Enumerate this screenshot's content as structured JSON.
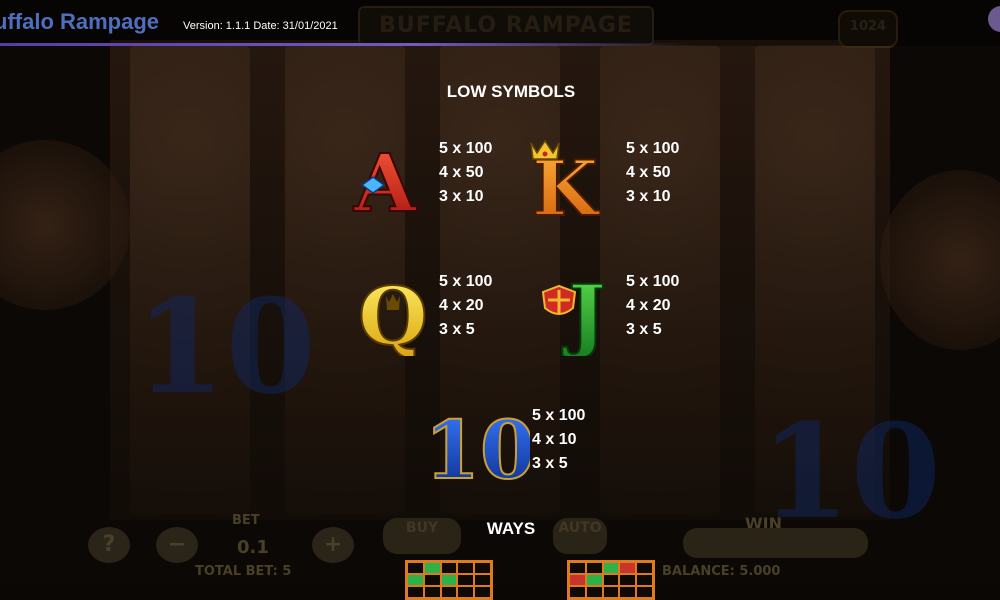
{
  "header": {
    "app_title": "uffalo Rampage",
    "version_text": "Version: 1.1.1    Date: 31/01/2021"
  },
  "background": {
    "logo_text": "BUFFALO RAMPAGE",
    "ways_badge": "1024",
    "bet_label": "BET",
    "bet_value": "0.1",
    "buy_label": "BUY",
    "auto_label": "AUTO",
    "win_label": "WIN",
    "total_bet": "TOTAL BET: 5",
    "balance": "BALANCE: 5.000",
    "help_icon": "?",
    "minus_icon": "−",
    "plus_icon": "+",
    "ten_glyph": "10"
  },
  "low_symbols": {
    "title": "LOW SYMBOLS",
    "items": [
      {
        "symbol": "A",
        "pays": [
          "5 x 100",
          "4 x 50",
          "3 x 10"
        ],
        "color": "#d42a1f"
      },
      {
        "symbol": "K",
        "pays": [
          "5 x 100",
          "4 x 50",
          "3 x 10"
        ],
        "color": "#f08a16"
      },
      {
        "symbol": "Q",
        "pays": [
          "5 x 100",
          "4 x 20",
          "3 x 5"
        ],
        "color": "#f7d21c"
      },
      {
        "symbol": "J",
        "pays": [
          "5 x 100",
          "4 x 20",
          "3 x 5"
        ],
        "color": "#2aa436"
      },
      {
        "symbol": "10",
        "pays": [
          "5 x 100",
          "4 x 10",
          "3 x 5"
        ],
        "color": "#1a43b8"
      }
    ]
  },
  "ways": {
    "title": "WAYS"
  },
  "colors": {
    "title_accent": "#4f6fbe",
    "grid_border": "#e07a1c",
    "grid_green": "#2bb34a",
    "grid_red": "#c7352d"
  }
}
